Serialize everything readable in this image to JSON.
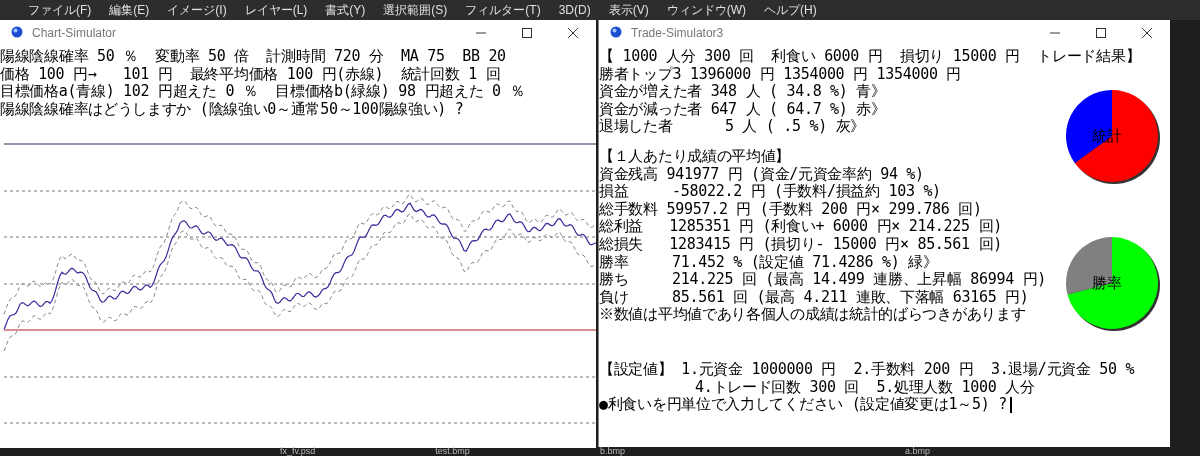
{
  "menu_bar": {
    "items": [
      "ファイル(F)",
      "編集(E)",
      "イメージ(I)",
      "レイヤー(L)",
      "書式(Y)",
      "選択範囲(S)",
      "フィルター(T)",
      "3D(D)",
      "表示(V)",
      "ウィンドウ(W)",
      "ヘルプ(H)"
    ]
  },
  "chart_window": {
    "title": "Chart-Simulator",
    "lines": [
      "陽線陰線確率 50 ％  変動率 50 倍  計測時間 720 分  MA 75  BB 20",
      "価格 100 円→   101 円  最終平均価格 100 円(赤線)  統計回数 1 回",
      "目標価格a(青線) 102 円超えた 0 ％  目標価格b(緑線) 98 円超えた 0 ％",
      "陽線陰線確率はどうしますか (陰線強い0～通常50～100陽線強い) ?"
    ]
  },
  "trade_window": {
    "title": "Trade-Simulator3",
    "result_lines": [
      "【 1000 人分 300 回  利食い 6000 円  損切り 15000 円  トレード結果】",
      "勝者トップ3 1396000 円 1354000 円 1354000 円",
      "資金が増えた者 348 人 ( 34.8 %) 青》",
      "資金が減った者 647 人 ( 64.7 %) 赤》",
      "退場した者      5 人 ( .5 %) 灰》"
    ],
    "average_lines": [
      "【１人あたり成績の平均値】",
      "資金残高 941977 円 (資金/元資金率約 94 %)",
      "損益     -58022.2 円 (手数料/損益約 103 %)",
      "総手数料 59957.2 円 (手数料 200 円× 299.786 回)",
      "総利益   1285351 円 (利食い+ 6000 円× 214.225 回)",
      "総損失   1283415 円 (損切り- 15000 円× 85.561 回)",
      "勝率     71.452 % (設定値 71.4286 %) 緑》",
      "勝ち     214.225 回 (最高 14.499 連勝、上昇幅 86994 円)",
      "負け     85.561 回 (最高 4.211 連敗、下落幅 63165 円)",
      "※数値は平均値であり各個人の成績は統計的ばらつきがあります"
    ],
    "settings_lines": [
      "【設定値】 1.元資金 1000000 円  2.手数料 200 円  3.退場/元資金 50 %",
      "           4.トレード回数 300 回  5.処理人数 1000 人分"
    ],
    "prompt": "●利食いを円単位で入力してください (設定値変更は1～5) ?",
    "pies": [
      {
        "label": "統計"
      },
      {
        "label": "勝率"
      }
    ]
  },
  "taskbar": {
    "items": [
      "fx_fv.psd",
      "test.bmp",
      "b.bmp",
      "a.bmp"
    ]
  }
}
